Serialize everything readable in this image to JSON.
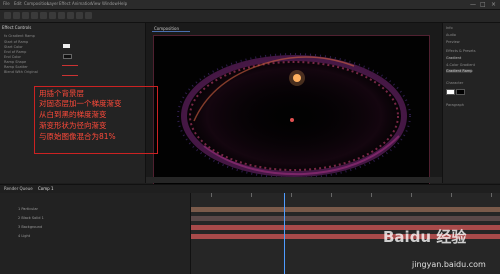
{
  "menu": [
    "File",
    "Edit",
    "Composition",
    "Layer",
    "Effect",
    "Animation",
    "View",
    "Window",
    "Help"
  ],
  "window_controls": [
    "—",
    "□",
    "×"
  ],
  "effects_panel": {
    "tab": "Effect Controls",
    "rows": [
      "fx Gradient Ramp",
      "Start of Ramp",
      "Start Color",
      "End of Ramp",
      "End Color",
      "Ramp Shape",
      "Ramp Scatter",
      "Blend With Original"
    ]
  },
  "annotation": {
    "lines": [
      "用插个背景层",
      "对固态层加一个梯度渐变",
      "从白到黑的梯度渐变",
      "渐变形状为径向渐变",
      "与原始图像混合为81%"
    ]
  },
  "composition": {
    "tab": "Composition"
  },
  "right_panel": {
    "rows": [
      "Info",
      "Audio",
      "Preview",
      "Effects & Presets",
      "Gradient",
      "4-Color Gradient",
      "Gradient Ramp",
      "Character",
      "Paragraph"
    ]
  },
  "timeline": {
    "tabs": [
      "Render Queue",
      "Comp 1"
    ],
    "layers": [
      "1  Particular",
      "2  Black Solid 1",
      "3  Background",
      "4  Light"
    ]
  },
  "watermark": {
    "brand": "Baidu 经验",
    "url": "jingyan.baidu.com"
  },
  "colors": {
    "accent_red": "#ff4a3a",
    "playhead": "#4f9cff"
  }
}
